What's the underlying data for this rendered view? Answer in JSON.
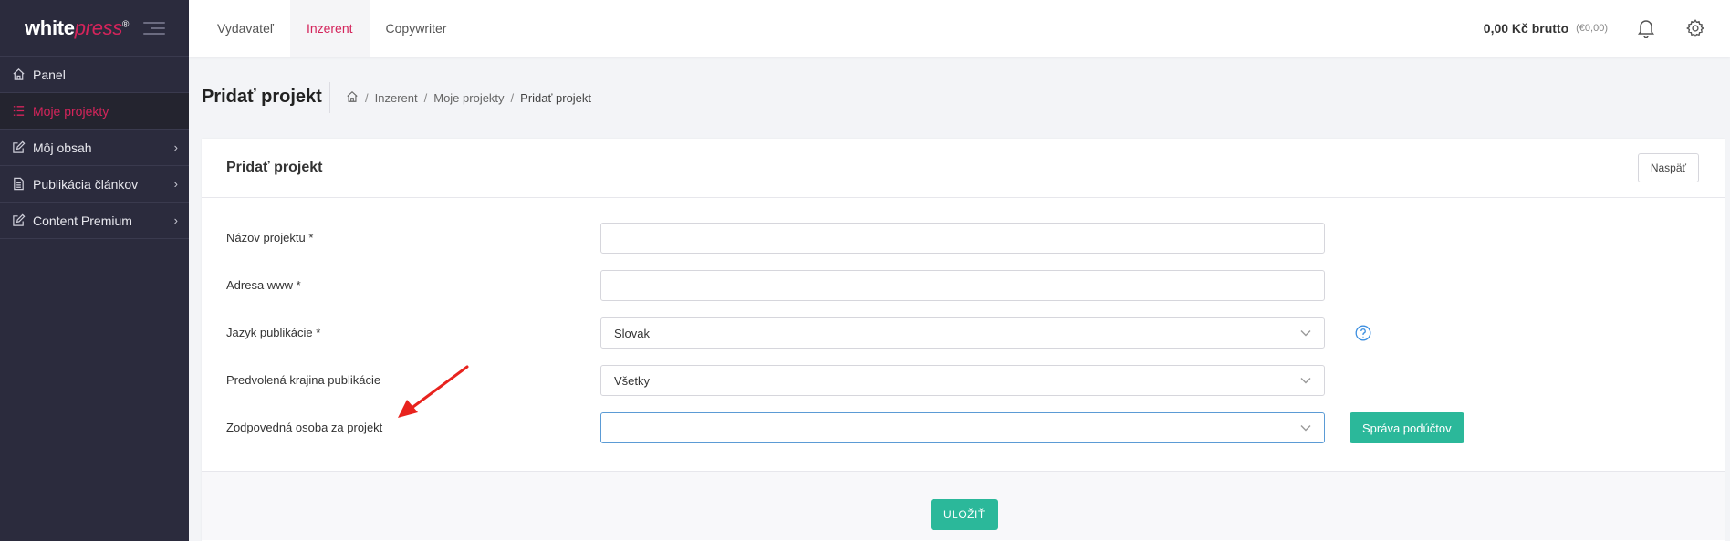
{
  "brand": {
    "name_white": "white",
    "name_press": "press",
    "registered": "®"
  },
  "sidebar": {
    "items": [
      {
        "label": "Panel",
        "icon": "home-icon",
        "active": false,
        "has_children": false
      },
      {
        "label": "Moje projekty",
        "icon": "list-icon",
        "active": true,
        "has_children": false
      },
      {
        "label": "Môj obsah",
        "icon": "edit-icon",
        "active": false,
        "has_children": true
      },
      {
        "label": "Publikácia článkov",
        "icon": "document-icon",
        "active": false,
        "has_children": true
      },
      {
        "label": "Content Premium",
        "icon": "edit-icon",
        "active": false,
        "has_children": true
      }
    ]
  },
  "topbar": {
    "tabs": [
      {
        "label": "Vydavateľ",
        "active": false
      },
      {
        "label": "Inzerent",
        "active": true
      },
      {
        "label": "Copywriter",
        "active": false
      }
    ],
    "balance": "0,00 Kč brutto",
    "balance_sub": "(€0,00)"
  },
  "page": {
    "title": "Pridať projekt",
    "breadcrumb": [
      "Inzerent",
      "Moje projekty",
      "Pridať projekt"
    ]
  },
  "card": {
    "title": "Pridať projekt",
    "back_label": "Naspäť",
    "fields": {
      "name": {
        "label": "Názov projektu *",
        "value": ""
      },
      "url": {
        "label": "Adresa www *",
        "value": ""
      },
      "language": {
        "label": "Jazyk publikácie *",
        "value": "Slovak"
      },
      "country": {
        "label": "Predvolená krajina publikácie",
        "value": "Všetky"
      },
      "person": {
        "label": "Zodpovedná osoba za projekt",
        "value": ""
      }
    },
    "subaccounts_label": "Správa podúčtov",
    "save_label": "ULOŽIŤ"
  },
  "colors": {
    "accent": "#d4245b",
    "green": "#2bb89a",
    "sidebar_bg": "#2b2b3d",
    "focus": "#5b9bd5",
    "arrow": "#e8231e"
  }
}
